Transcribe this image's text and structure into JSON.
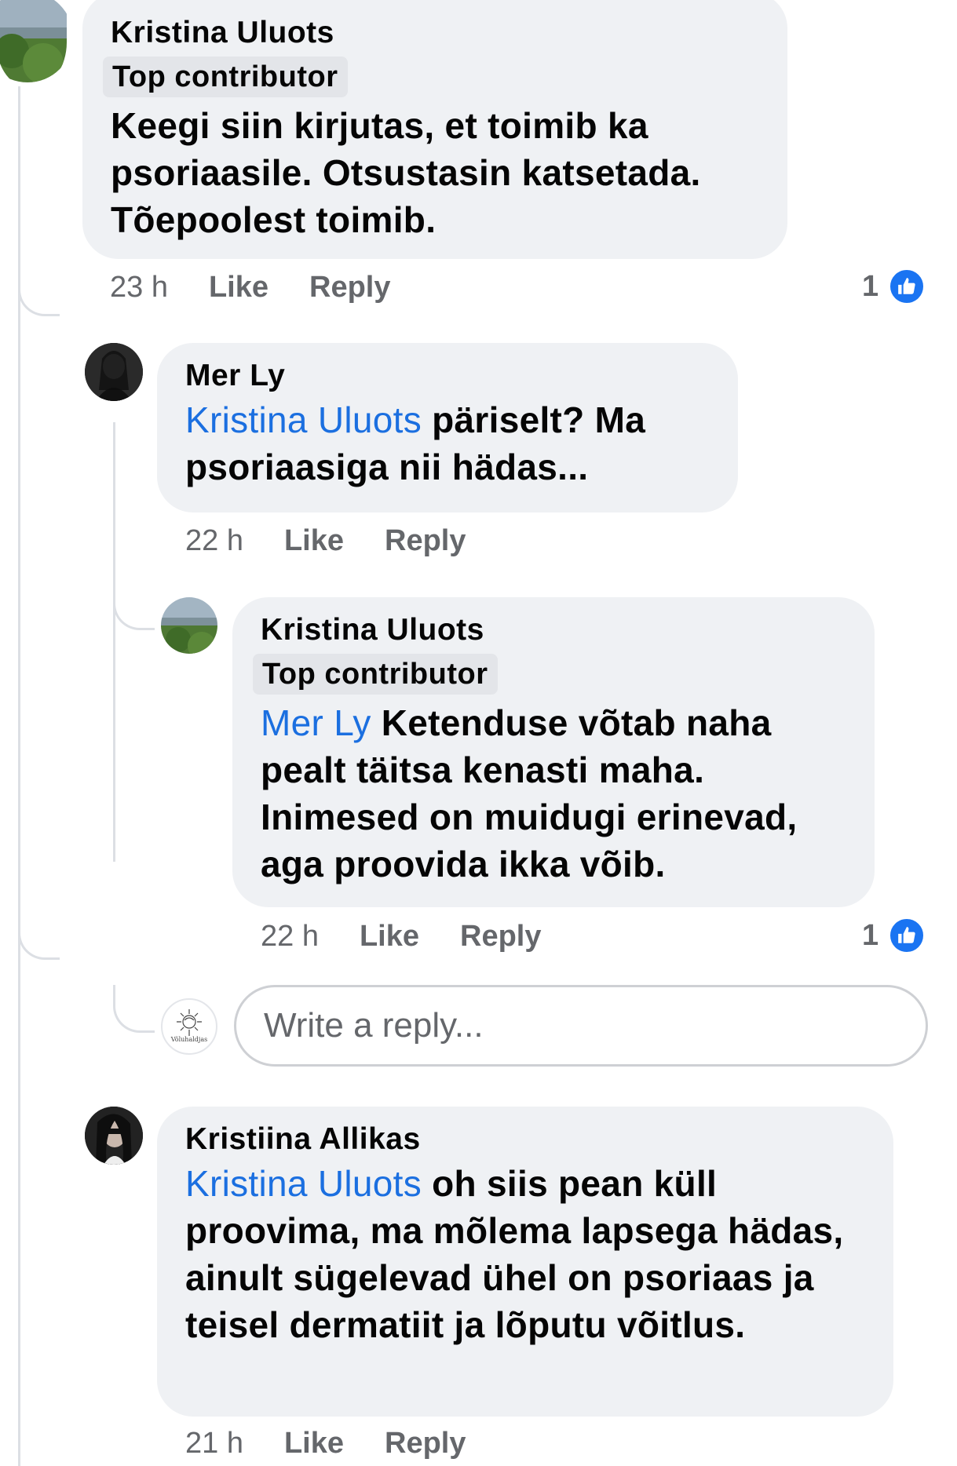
{
  "comments": [
    {
      "author": "Kristina Uluots",
      "badge": "Top contributor",
      "text": "Keegi siin kirjutas, et toimib ka psoriaasile. Otsustasin katsetada. Tõepoolest toimib.",
      "time": "23 h",
      "like_label": "Like",
      "reply_label": "Reply",
      "reaction_count": "1"
    },
    {
      "author": "Mer Ly",
      "mention": "Kristina Uluots",
      "text": " päriselt? Ma psoriaasiga nii hädas...",
      "time": "22 h",
      "like_label": "Like",
      "reply_label": "Reply"
    },
    {
      "author": "Kristina Uluots",
      "badge": "Top contributor",
      "mention": "Mer Ly",
      "text": "  Ketenduse võtab naha pealt täitsa kenasti maha. Inimesed on muidugi erinevad, aga proovida ikka võib.",
      "time": "22 h",
      "like_label": "Like",
      "reply_label": "Reply",
      "reaction_count": "1"
    },
    {
      "author": "Kristiina Allikas",
      "mention": "Kristina Uluots",
      "text": " oh siis pean küll proovima, ma mõlema lapsega hädas, ainult sügelevad ühel on psoriaas ja teisel dermatiit ja lõputu võitlus.",
      "time": "21 h",
      "like_label": "Like",
      "reply_label": "Reply"
    }
  ],
  "reply_box": {
    "placeholder": "Write a reply...",
    "avatar_logo_text": "Võluhaldjas"
  },
  "colors": {
    "bubble": "#eff1f4",
    "mention": "#1b6fe0",
    "meta": "#65676b",
    "like_blue": "#1a74f2"
  }
}
